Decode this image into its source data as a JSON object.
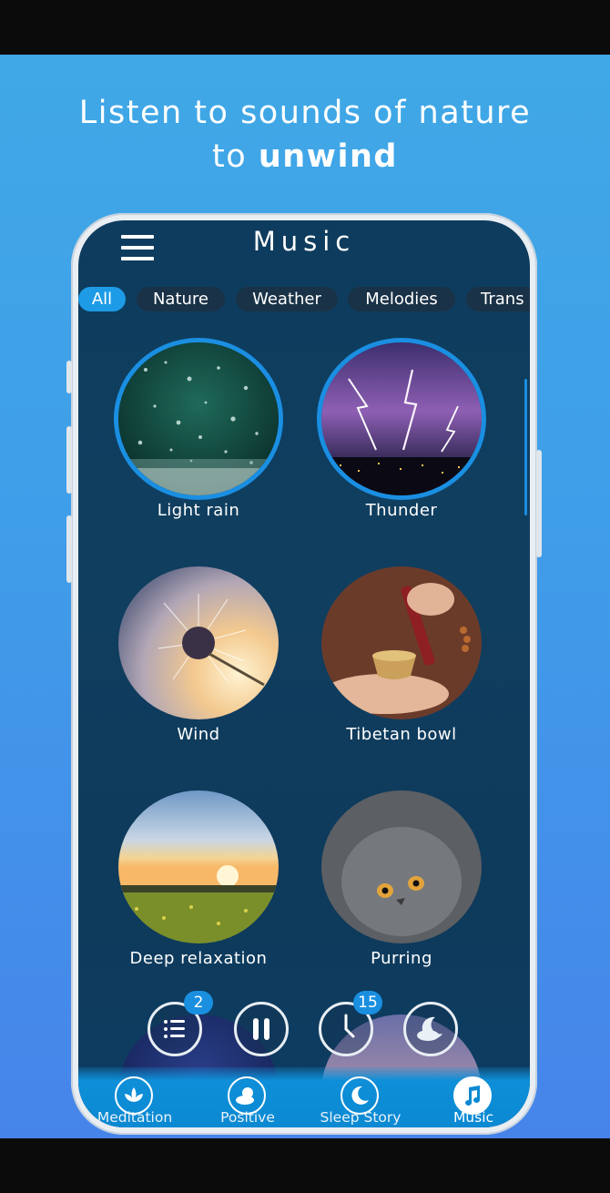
{
  "headline": {
    "line1": "Listen to sounds of nature",
    "line2_prefix": "to ",
    "line2_bold": "unwind"
  },
  "app": {
    "title": "Music"
  },
  "tabs": [
    {
      "label": "All",
      "active": true
    },
    {
      "label": "Nature",
      "active": false
    },
    {
      "label": "Weather",
      "active": false
    },
    {
      "label": "Melodies",
      "active": false
    },
    {
      "label": "Trans",
      "active": false
    }
  ],
  "sounds": [
    {
      "label": "Light rain",
      "selected": true
    },
    {
      "label": "Thunder",
      "selected": true
    },
    {
      "label": "Wind",
      "selected": false
    },
    {
      "label": "Tibetan bowl",
      "selected": false
    },
    {
      "label": "Deep relaxation",
      "selected": false
    },
    {
      "label": "Purring",
      "selected": false
    }
  ],
  "player": {
    "playlist_badge": "2",
    "timer_badge": "15",
    "icons": [
      "playlist-icon",
      "pause-icon",
      "timer-icon",
      "sleep-moon-cloud-icon"
    ]
  },
  "nav": [
    {
      "label": "Meditation",
      "icon": "lotus-icon",
      "active": false
    },
    {
      "label": "Positive",
      "icon": "sun-cloud-icon",
      "active": false
    },
    {
      "label": "Sleep Story",
      "icon": "moon-icon",
      "active": false
    },
    {
      "label": "Music",
      "icon": "music-note-icon",
      "active": true
    }
  ],
  "colors": {
    "accent": "#1e9be6",
    "screen_bg": "#0e3c5e",
    "promo_bg": "#40a8e6",
    "nav_bg": "#0b89d2"
  }
}
